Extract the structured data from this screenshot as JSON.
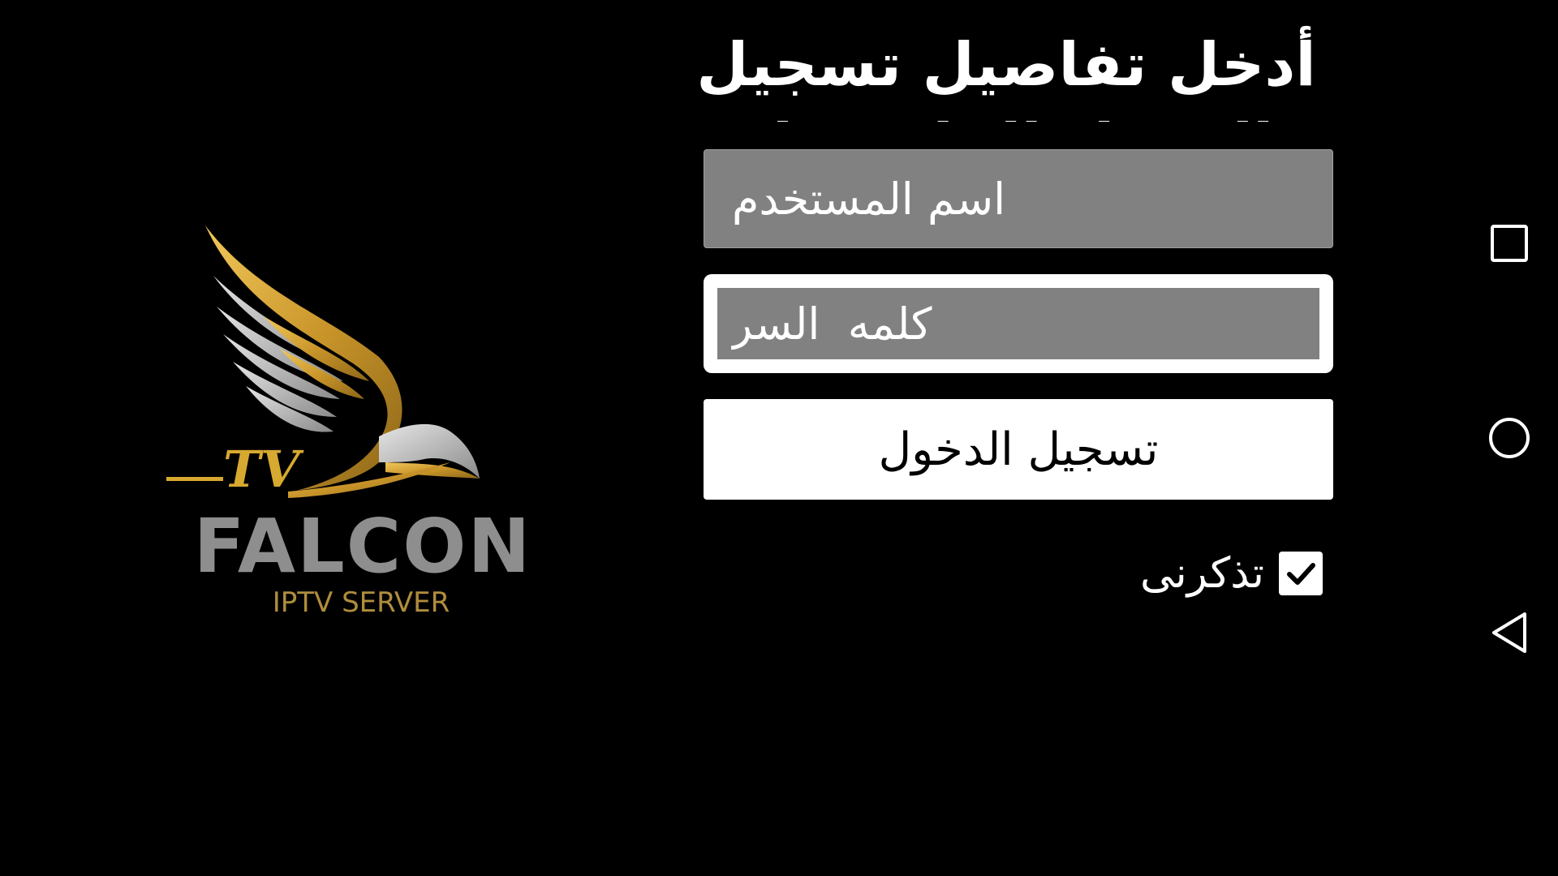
{
  "login": {
    "title": "أدخل تفاصيل تسجيل الدخول الخاصة بك",
    "username_placeholder": "اسم المستخدم",
    "password_placeholder": "كلمه  السر",
    "login_button": "تسجيل الدخول",
    "remember_me_label": "تذكرنى",
    "remember_me_checked": true
  },
  "logo": {
    "tv_text": "TV",
    "brand_text": "FALCON",
    "subtitle": "IPTV SERVER"
  },
  "navbar": {
    "buttons": [
      "recent-apps",
      "home",
      "back"
    ]
  },
  "colors": {
    "background": "#000000",
    "field_gray": "#818181",
    "gold": "#d7a930",
    "logo_gray": "#8e8e8e"
  }
}
